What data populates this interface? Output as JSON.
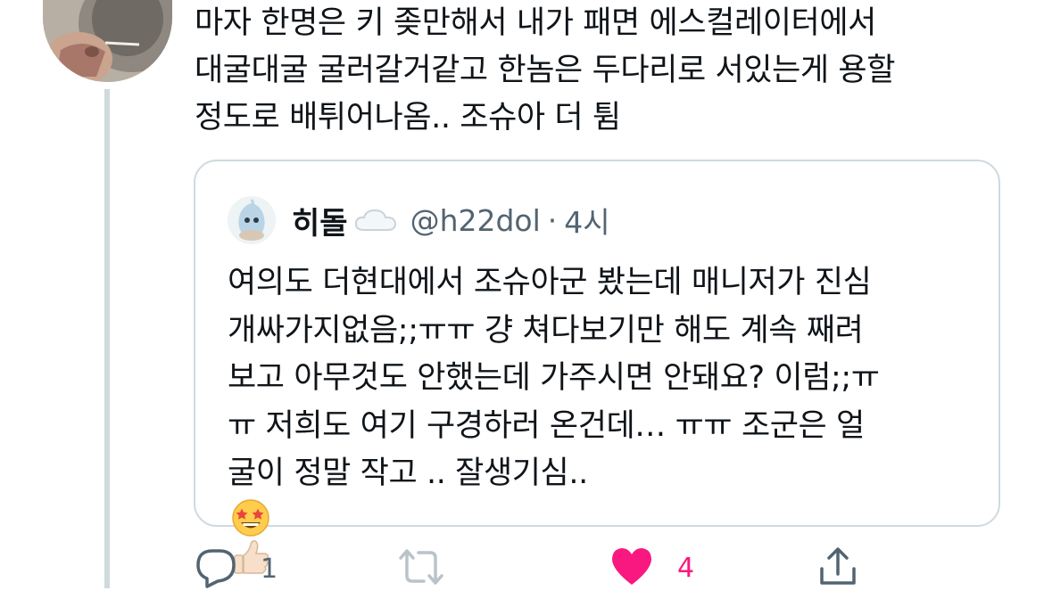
{
  "tweet": {
    "lines": [
      "마자 한명은 키 좆만해서 내가 패면 에스컬레이터에서",
      "대굴대굴 굴러갈거같고 한놈은 두다리로 서있는게 용할",
      "정도로 배튀어나옴.. 조슈아 더 튐"
    ]
  },
  "quote": {
    "name": "히돌",
    "name_emoji": "cloud",
    "handle": "@h22dol",
    "separator": "·",
    "time": "4시",
    "lines": [
      "여의도 더현대에서 조슈아군 봤는데 매니저가 진심",
      "개싸가지없음;;ㅠㅠ 걍 쳐다보기만 해도 계속 째려",
      "보고 아무것도 안했는데 가주시면 안돼요? 이럼;;ㅠ",
      "ㅠ 저희도 여기 구경하러 온건데… ㅠㅠ 조군은 얼",
      "굴이 정말 작고 .. 잘생기심.."
    ],
    "trailing_emojis": [
      "star-struck",
      "thumbs-up-light-skin"
    ]
  },
  "actions": {
    "reply_count": "1",
    "retweet_count": "",
    "like_count": "4",
    "colors": {
      "muted": "#536471",
      "like": "#f91880",
      "border": "#cfd9de"
    }
  }
}
